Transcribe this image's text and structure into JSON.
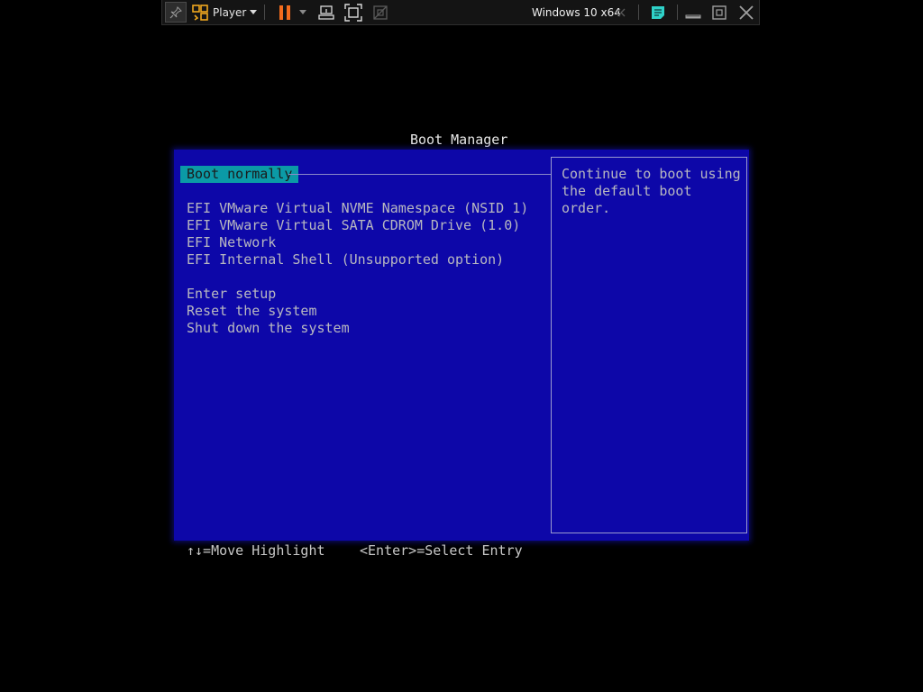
{
  "toolbar": {
    "player_label": "Player",
    "vm_name": "Windows 10 x64",
    "icons": [
      "pin-icon",
      "player-logo-icon",
      "dropdown-arrow-icon",
      "pause-icon",
      "send-ctrl-alt-del-icon",
      "fit-guest-icon",
      "unity-icon",
      "collapse-icon",
      "message-log-icon",
      "minimize-icon",
      "restore-icon",
      "close-icon"
    ],
    "colors": {
      "background": "#141414",
      "pause": "#f26b1d",
      "accent": "#2fd1c8"
    }
  },
  "boot_manager": {
    "title": "Boot Manager",
    "selected_index": 0,
    "items": [
      {
        "label": "Boot normally"
      },
      {
        "label": "EFI VMware Virtual NVME Namespace (NSID 1)"
      },
      {
        "label": "EFI VMware Virtual SATA CDROM Drive (1.0)"
      },
      {
        "label": "EFI Network"
      },
      {
        "label": "EFI Internal Shell (Unsupported option)"
      },
      {
        "label": "Enter setup"
      },
      {
        "label": "Reset the system"
      },
      {
        "label": "Shut down the system"
      }
    ],
    "help_text": "Continue to boot using\nthe default boot order.",
    "footer": {
      "move_hint": "↑↓=Move Highlight",
      "select_hint": "<Enter>=Select Entry"
    },
    "colors": {
      "panel": "#0d07a8",
      "highlight": "#0b9aa6",
      "text": "#b8b8c0"
    }
  }
}
